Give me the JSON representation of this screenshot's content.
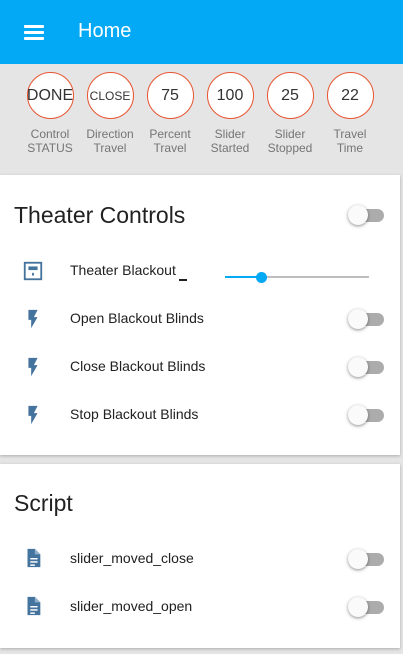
{
  "appbar": {
    "title": "Home",
    "menu_icon": "menu-icon",
    "color": "#03a9f4"
  },
  "badges": [
    {
      "value": "DONE",
      "label_line1": "Control",
      "label_line2": "STATUS"
    },
    {
      "value": "CLOSE",
      "label_line1": "Direction",
      "label_line2": "Travel"
    },
    {
      "value": "75",
      "label_line1": "Percent",
      "label_line2": "Travel"
    },
    {
      "value": "100",
      "label_line1": "Slider",
      "label_line2": "Started"
    },
    {
      "value": "25",
      "label_line1": "Slider",
      "label_line2": "Stopped"
    },
    {
      "value": "22",
      "label_line1": "Travel",
      "label_line2": "Time"
    }
  ],
  "badge_border_color": "#e8542f",
  "theater": {
    "title": "Theater Controls",
    "group_toggle_on": false,
    "rows": [
      {
        "icon": "window-shutter-icon",
        "label": "Theater Blackout",
        "control": "slider",
        "slider_level_percent": 25
      },
      {
        "icon": "flash-icon",
        "label": "Open Blackout Blinds",
        "control": "toggle",
        "on": false
      },
      {
        "icon": "flash-icon",
        "label": "Close Blackout Blinds",
        "control": "toggle",
        "on": false
      },
      {
        "icon": "flash-icon",
        "label": "Stop Blackout Blinds",
        "control": "toggle",
        "on": false
      }
    ]
  },
  "script": {
    "title": "Script",
    "rows": [
      {
        "icon": "file-document-icon",
        "label": "slider_moved_close",
        "on": false
      },
      {
        "icon": "file-document-icon",
        "label": "slider_moved_open",
        "on": false
      }
    ]
  },
  "icon_color": "#44739e"
}
